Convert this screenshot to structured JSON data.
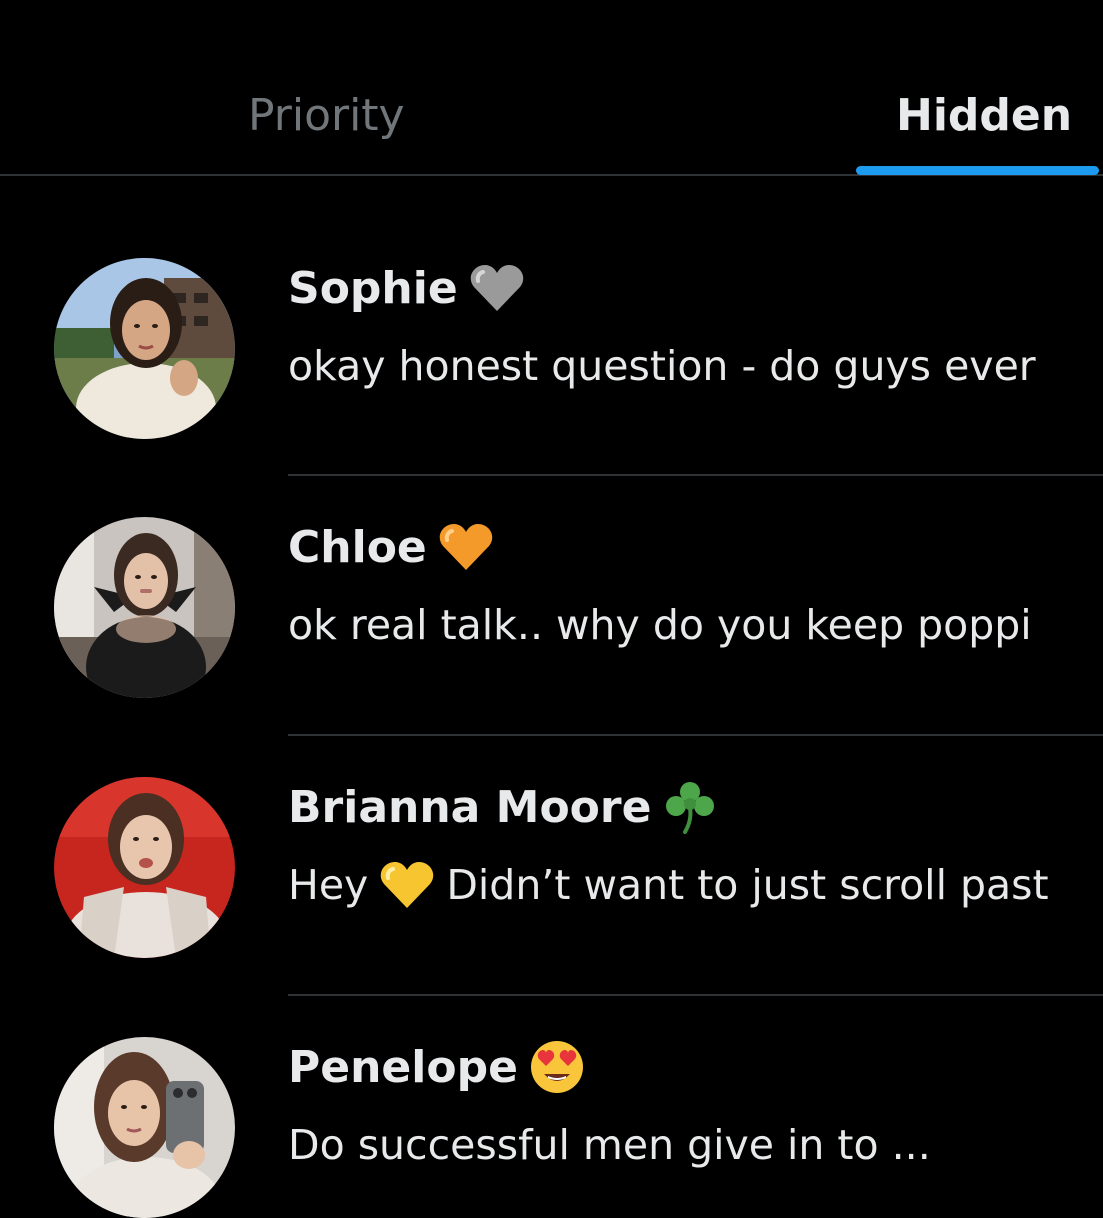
{
  "tabs": [
    {
      "label": "Priority",
      "active": false
    },
    {
      "label": "Hidden",
      "active": true
    }
  ],
  "colors": {
    "background": "#000000",
    "text_primary": "#e7e9ea",
    "text_secondary": "#71767b",
    "accent": "#1d9bf0",
    "divider": "#2f3336"
  },
  "conversations": [
    {
      "name": "Sophie",
      "name_emoji": "grey-heart-icon",
      "preview_start": "okay honest question - do guys ever",
      "preview_emoji": null,
      "preview_rest": ""
    },
    {
      "name": "Chloe",
      "name_emoji": "orange-heart-icon",
      "preview_start": "ok real talk.. why do you keep poppi",
      "preview_emoji": null,
      "preview_rest": ""
    },
    {
      "name": "Brianna Moore",
      "name_emoji": "shamrock-icon",
      "preview_start": "Hey",
      "preview_emoji": "yellow-heart-icon",
      "preview_rest": "Didn’t want to just scroll past"
    },
    {
      "name": "Penelope",
      "name_emoji": "heart-eyes-face-icon",
      "preview_start": "Do successful men give in to ...",
      "preview_emoji": null,
      "preview_rest": ""
    }
  ]
}
